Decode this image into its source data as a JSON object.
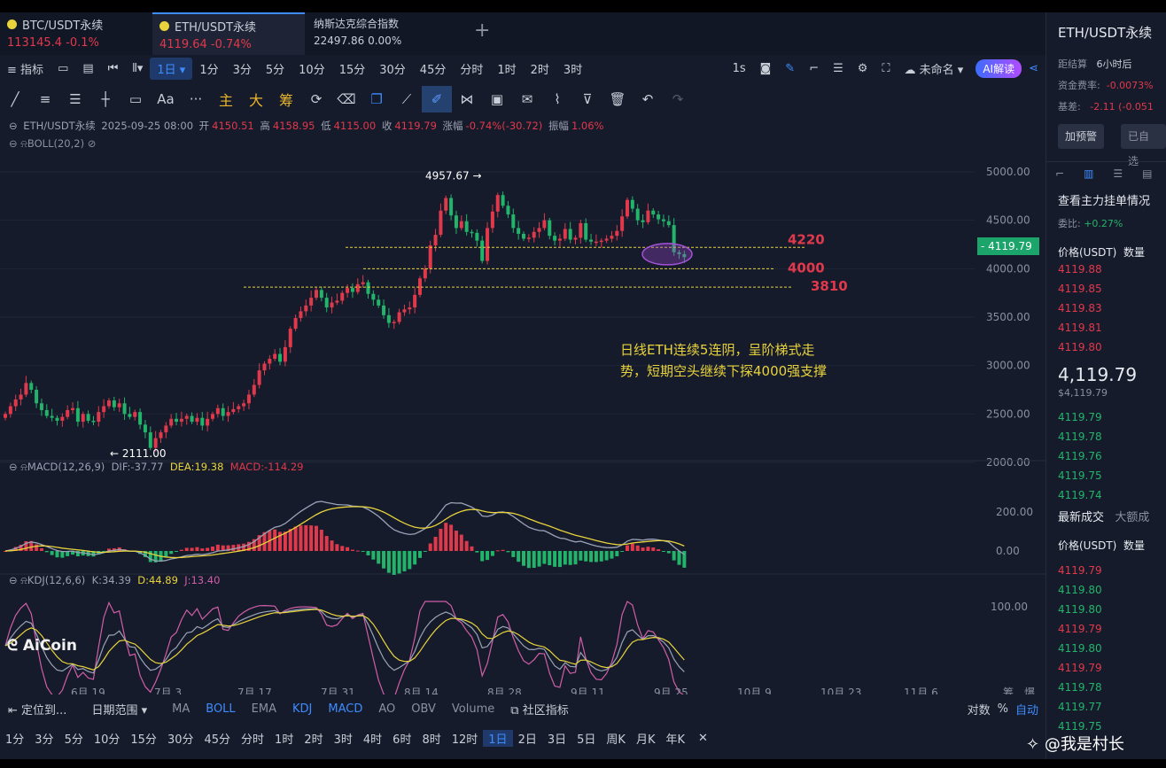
{
  "tabs": [
    {
      "name": "BTC/USDT永续",
      "price": "113145.4",
      "change": "-0.1%",
      "dot": "#e8d33c"
    },
    {
      "name": "ETH/USDT永续",
      "price": "4119.64",
      "change": "-0.74%",
      "dot": "#e8d33c"
    },
    {
      "name": "纳斯达克综合指数",
      "price": "22497.86",
      "change": "0.00%"
    }
  ],
  "add_tab": "+",
  "toolbar": {
    "indicator_label": "指标",
    "interval_selected": "1日",
    "intervals": [
      "1分",
      "3分",
      "5分",
      "10分",
      "15分",
      "30分",
      "45分",
      "分时",
      "1时",
      "2时",
      "3时"
    ],
    "interval_1s": "1s",
    "layout_name": "未命名",
    "ai_button": "AI解读"
  },
  "drawing_tools": {
    "text_tool": "Aa",
    "more": "···",
    "gold_labels": [
      "主",
      "大",
      "筹"
    ]
  },
  "ohlc": {
    "symbol": "ETH/USDT永续",
    "date": "2025-09-25 08:00",
    "open_label": "开",
    "open": "4150.51",
    "high_label": "高",
    "high": "4158.95",
    "low_label": "低",
    "low": "4115.00",
    "close_label": "收",
    "close": "4119.79",
    "change_label": "涨幅",
    "change": "-0.74%(-30.72)",
    "amp_label": "振幅",
    "amp": "1.06%"
  },
  "boll_label": "BOLL(20,2)",
  "macd": {
    "label": "MACD(12,26,9)",
    "dif": "DIF:-37.77",
    "dea": "DEA:19.38",
    "macd": "MACD:-114.29"
  },
  "kdj": {
    "label": "KDJ(12,6,6)",
    "k": "K:34.39",
    "d": "D:44.89",
    "j": "J:13.40"
  },
  "annotations": {
    "high_marker": "4957.67",
    "low_marker": "2111.00",
    "level_4220": "4220",
    "level_4000": "4000",
    "level_3810": "3810",
    "comment_line1": "日线ETH连续5连阴，呈阶梯式走",
    "comment_line2": "势，短期空头继续下探4000强支撑"
  },
  "watermark": "AiCoin",
  "credit": "@我是村长",
  "last_price_label": "4119.79",
  "price_axis": [
    "5000.00",
    "4500.00",
    "4000.00",
    "3500.00",
    "3000.00",
    "2500.00",
    "2000.00"
  ],
  "macd_axis": [
    "200.00",
    "0.00"
  ],
  "kdj_axis": [
    "100.00"
  ],
  "date_axis": [
    "6月 19",
    "7月 3",
    "7月 17",
    "7月 31",
    "8月 14",
    "8月 28",
    "9月 11",
    "9月 25",
    "10月 9",
    "10月 23",
    "11月 6"
  ],
  "corner_labels": [
    "筹",
    "爆"
  ],
  "bottom_bar": {
    "locate": "定位到...",
    "date_range": "日期范围",
    "indicators": [
      {
        "label": "MA",
        "active": false
      },
      {
        "label": "BOLL",
        "active": true
      },
      {
        "label": "EMA",
        "active": false
      },
      {
        "label": "KDJ",
        "active": true
      },
      {
        "label": "MACD",
        "active": true
      },
      {
        "label": "AO",
        "active": false
      },
      {
        "label": "OBV",
        "active": false
      },
      {
        "label": "Volume",
        "active": false
      }
    ],
    "community": "社区指标",
    "log": "对数",
    "percent": "%",
    "auto": "自动"
  },
  "bottom_intervals": [
    "1分",
    "3分",
    "5分",
    "10分",
    "15分",
    "30分",
    "45分",
    "分时",
    "1时",
    "2时",
    "3时",
    "4时",
    "6时",
    "8时",
    "12时",
    "1日",
    "2日",
    "3日",
    "5日",
    "周K",
    "月K",
    "年K"
  ],
  "bottom_active_interval": "1日",
  "sidebar": {
    "title": "ETH/USDT永续",
    "settle_label": "距结算",
    "settle_value": "6小时后",
    "funding_label": "资金费率:",
    "funding_value": "-0.0073%",
    "basis_label": "基差:",
    "basis_value": "-2.11 (-0.051",
    "alert_button": "加预警",
    "selected_button": "已自选",
    "orderbook_title": "查看主力挂单情况",
    "ratio_label": "委比:",
    "ratio_value": "+0.27%",
    "price_header": "价格(USDT)",
    "qty_header": "数量",
    "asks": [
      "4119.88",
      "4119.85",
      "4119.83",
      "4119.81",
      "4119.80"
    ],
    "mid_price": "4,119.79",
    "mid_sub": "$4,119.79",
    "bids": [
      "4119.79",
      "4119.78",
      "4119.76",
      "4119.75",
      "4119.74"
    ],
    "trades_tab": "最新成交",
    "trades_tab2": "大额成",
    "trades": [
      {
        "p": "4119.79",
        "side": "sell"
      },
      {
        "p": "4119.80",
        "side": "buy"
      },
      {
        "p": "4119.80",
        "side": "buy"
      },
      {
        "p": "4119.79",
        "side": "sell"
      },
      {
        "p": "4119.80",
        "side": "buy"
      },
      {
        "p": "4119.79",
        "side": "sell"
      },
      {
        "p": "4119.78",
        "side": "buy"
      },
      {
        "p": "4119.77",
        "side": "buy"
      },
      {
        "p": "4119.75",
        "side": "buy"
      }
    ]
  },
  "colors": {
    "up": "#e0394b",
    "down": "#22b46a",
    "accent": "#3d8cff",
    "annotation": "#e8d33c",
    "level": "#e0394b"
  },
  "chart_data": {
    "type": "candlestick",
    "title": "ETH/USDT永续",
    "interval": "1日",
    "x_tick_labels": [
      "6月 19",
      "7月 3",
      "7月 17",
      "7月 31",
      "8月 14",
      "8月 28",
      "9月 11",
      "9月 25",
      "10月 9",
      "10月 23",
      "11月 6"
    ],
    "ylim": [
      1800,
      5200
    ],
    "y_ticks": [
      2000,
      2500,
      3000,
      3500,
      4000,
      4500,
      5000
    ],
    "close": [
      2500,
      2580,
      2650,
      2700,
      2820,
      2750,
      2610,
      2540,
      2480,
      2460,
      2430,
      2470,
      2540,
      2560,
      2420,
      2500,
      2430,
      2420,
      2520,
      2580,
      2640,
      2570,
      2610,
      2500,
      2470,
      2520,
      2390,
      2310,
      2150,
      2250,
      2310,
      2380,
      2450,
      2420,
      2450,
      2480,
      2420,
      2460,
      2380,
      2450,
      2500,
      2560,
      2480,
      2520,
      2550,
      2580,
      2610,
      2700,
      2800,
      2950,
      3020,
      3070,
      3120,
      3040,
      3190,
      3380,
      3490,
      3560,
      3620,
      3700,
      3780,
      3700,
      3600,
      3650,
      3670,
      3750,
      3800,
      3760,
      3840,
      3860,
      3740,
      3680,
      3620,
      3520,
      3440,
      3450,
      3550,
      3580,
      3600,
      3730,
      3900,
      4000,
      4240,
      4350,
      4600,
      4730,
      4550,
      4420,
      4490,
      4380,
      4370,
      4290,
      4080,
      4420,
      4590,
      4760,
      4650,
      4560,
      4420,
      4360,
      4310,
      4320,
      4380,
      4420,
      4500,
      4340,
      4290,
      4310,
      4410,
      4300,
      4320,
      4470,
      4300,
      4280,
      4280,
      4290,
      4310,
      4340,
      4390,
      4540,
      4710,
      4620,
      4500,
      4480,
      4600,
      4560,
      4510,
      4490,
      4450,
      4170,
      4150,
      4120
    ],
    "levels": [
      4220,
      4000,
      3810
    ],
    "annotated_high": 4957.67,
    "annotated_low": 2111.0,
    "last_price": 4119.79,
    "macd_axis_ticks": [
      200,
      0
    ],
    "kdj_axis_ticks": [
      100
    ]
  }
}
